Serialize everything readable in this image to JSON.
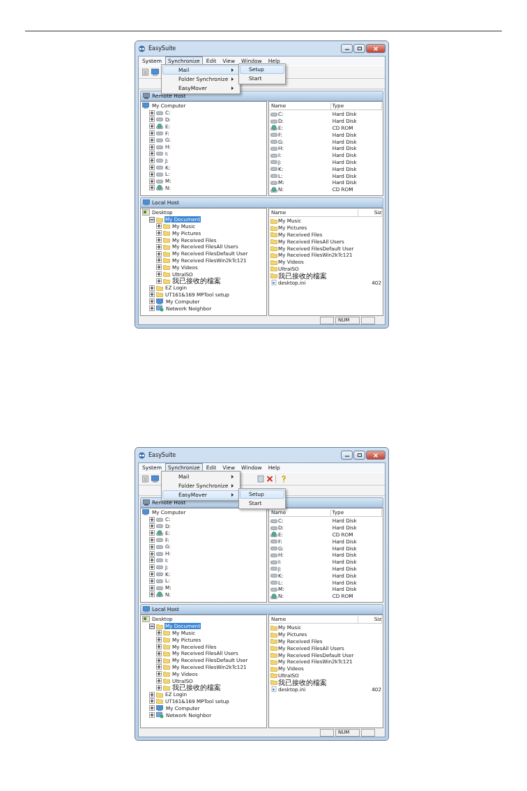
{
  "screenshots": [
    {
      "window": {
        "title": "EasySuite"
      },
      "menu_bar": [
        {
          "label": "System",
          "selected": false
        },
        {
          "label": "Synchronize",
          "selected": true
        },
        {
          "label": "Edit",
          "selected": false
        },
        {
          "label": "View",
          "selected": false
        },
        {
          "label": "Window",
          "selected": false
        },
        {
          "label": "Help",
          "selected": false
        }
      ],
      "open_menu": [
        {
          "label": "Mail",
          "selected": true
        },
        {
          "label": "Folder Synchronize",
          "selected": false
        },
        {
          "label": "EasyMover",
          "selected": false
        }
      ],
      "submenu": [
        {
          "label": "Setup",
          "selected": true
        },
        {
          "label": "Start",
          "selected": false
        }
      ],
      "remote_host": {
        "title": "Remote Host",
        "tree": {
          "label": "My Computer",
          "kind": "computer",
          "selected": false,
          "children": [
            {
              "label": "C:",
              "kind": "disk",
              "expanded": false,
              "selected": false
            },
            {
              "label": "D:",
              "kind": "disk",
              "expanded": false,
              "selected": false
            },
            {
              "label": "E:",
              "kind": "cdrom",
              "expanded": false,
              "selected": false
            },
            {
              "label": "F:",
              "kind": "disk",
              "expanded": false,
              "selected": false
            },
            {
              "label": "G:",
              "kind": "disk",
              "expanded": false,
              "selected": false
            },
            {
              "label": "H:",
              "kind": "disk",
              "expanded": false,
              "selected": false
            },
            {
              "label": "I:",
              "kind": "disk",
              "expanded": false,
              "selected": false
            },
            {
              "label": "J:",
              "kind": "disk",
              "expanded": false,
              "selected": false
            },
            {
              "label": "K:",
              "kind": "disk",
              "expanded": false,
              "selected": false
            },
            {
              "label": "L:",
              "kind": "disk",
              "expanded": false,
              "selected": false
            },
            {
              "label": "M:",
              "kind": "disk",
              "expanded": false,
              "selected": false
            },
            {
              "label": "N:",
              "kind": "cdrom",
              "expanded": false,
              "selected": false
            }
          ]
        },
        "columns": [
          "Name",
          "Type"
        ],
        "rows": [
          {
            "name": "C:",
            "value": "Hard Disk",
            "kind": "disk"
          },
          {
            "name": "D:",
            "value": "Hard Disk",
            "kind": "disk"
          },
          {
            "name": "E:",
            "value": "CD ROM",
            "kind": "cdrom"
          },
          {
            "name": "F:",
            "value": "Hard Disk",
            "kind": "disk"
          },
          {
            "name": "G:",
            "value": "Hard Disk",
            "kind": "disk"
          },
          {
            "name": "H:",
            "value": "Hard Disk",
            "kind": "disk"
          },
          {
            "name": "I:",
            "value": "Hard Disk",
            "kind": "disk"
          },
          {
            "name": "J:",
            "value": "Hard Disk",
            "kind": "disk"
          },
          {
            "name": "K:",
            "value": "Hard Disk",
            "kind": "disk"
          },
          {
            "name": "L:",
            "value": "Hard Disk",
            "kind": "disk"
          },
          {
            "name": "M:",
            "value": "Hard Disk",
            "kind": "disk"
          },
          {
            "name": "N:",
            "value": "CD ROM",
            "kind": "cdrom"
          }
        ]
      },
      "local_host": {
        "title": "Local Host",
        "tree": {
          "label": "Desktop",
          "kind": "desktop",
          "selected": false,
          "children": [
            {
              "label": "My Document",
              "kind": "folder",
              "expanded": true,
              "selected": true,
              "children": [
                {
                  "label": "My Music",
                  "kind": "folder",
                  "expanded": false,
                  "selected": false
                },
                {
                  "label": "My Pictures",
                  "kind": "folder",
                  "expanded": false,
                  "selected": false
                },
                {
                  "label": "My Received Files",
                  "kind": "folder",
                  "expanded": false,
                  "selected": false
                },
                {
                  "label": "My Received FilesAll Users",
                  "kind": "folder",
                  "expanded": false,
                  "selected": false
                },
                {
                  "label": "My Received FilesDefault User",
                  "kind": "folder",
                  "expanded": false,
                  "selected": false
                },
                {
                  "label": "My Received FilesWin2kTc121",
                  "kind": "folder",
                  "expanded": false,
                  "selected": false
                },
                {
                  "label": "My Videos",
                  "kind": "folder",
                  "expanded": false,
                  "selected": false
                },
                {
                  "label": "UltraISO",
                  "kind": "folder",
                  "expanded": false,
                  "selected": false
                },
                {
                  "label": "我已接收的檔案",
                  "kind": "folder",
                  "expanded": false,
                  "selected": false
                }
              ]
            },
            {
              "label": "EZ Login",
              "kind": "folder",
              "expanded": false,
              "selected": false
            },
            {
              "label": "UT161&169 MPTool setup",
              "kind": "folder",
              "expanded": false,
              "selected": false
            },
            {
              "label": "My Computer",
              "kind": "computer",
              "expanded": false,
              "selected": false
            },
            {
              "label": "Network Neighbor",
              "kind": "network",
              "expanded": false,
              "selected": false
            }
          ]
        },
        "columns": [
          "Name",
          "Siz"
        ],
        "rows": [
          {
            "name": "My Music",
            "kind": "folder"
          },
          {
            "name": "My Pictures",
            "kind": "folder"
          },
          {
            "name": "My Received Files",
            "kind": "folder"
          },
          {
            "name": "My Received FilesAll Users",
            "kind": "folder"
          },
          {
            "name": "My Received FilesDefault User",
            "kind": "folder"
          },
          {
            "name": "My Received FilesWin2kTc121",
            "kind": "folder"
          },
          {
            "name": "My Videos",
            "kind": "folder"
          },
          {
            "name": "UltraISO",
            "kind": "folder"
          },
          {
            "name": "我已接收的檔案",
            "kind": "folder"
          },
          {
            "name": "desktop.ini",
            "value": "402",
            "kind": "file"
          }
        ]
      },
      "status_bar": [
        "NUM"
      ]
    },
    {
      "window": {
        "title": "EasySuite"
      },
      "menu_bar": [
        {
          "label": "System",
          "selected": false
        },
        {
          "label": "Synchronize",
          "selected": true
        },
        {
          "label": "Edit",
          "selected": false
        },
        {
          "label": "View",
          "selected": false
        },
        {
          "label": "Window",
          "selected": false
        },
        {
          "label": "Help",
          "selected": false
        }
      ],
      "open_menu": [
        {
          "label": "Mail",
          "selected": false
        },
        {
          "label": "Folder Synchronize",
          "selected": false
        },
        {
          "label": "EasyMover",
          "selected": true
        }
      ],
      "submenu": [
        {
          "label": "Setup",
          "selected": true
        },
        {
          "label": "Start",
          "selected": false
        }
      ],
      "remote_host": {
        "title": "Remote Host",
        "tree": {
          "label": "My Computer",
          "kind": "computer",
          "selected": false,
          "children": [
            {
              "label": "C:",
              "kind": "disk",
              "expanded": false,
              "selected": false
            },
            {
              "label": "D:",
              "kind": "disk",
              "expanded": false,
              "selected": false
            },
            {
              "label": "E:",
              "kind": "cdrom",
              "expanded": false,
              "selected": false
            },
            {
              "label": "F:",
              "kind": "disk",
              "expanded": false,
              "selected": false
            },
            {
              "label": "G:",
              "kind": "disk",
              "expanded": false,
              "selected": false
            },
            {
              "label": "H:",
              "kind": "disk",
              "expanded": false,
              "selected": false
            },
            {
              "label": "I:",
              "kind": "disk",
              "expanded": false,
              "selected": false
            },
            {
              "label": "J:",
              "kind": "disk",
              "expanded": false,
              "selected": false
            },
            {
              "label": "K:",
              "kind": "disk",
              "expanded": false,
              "selected": false
            },
            {
              "label": "L:",
              "kind": "disk",
              "expanded": false,
              "selected": false
            },
            {
              "label": "M:",
              "kind": "disk",
              "expanded": false,
              "selected": false
            },
            {
              "label": "N:",
              "kind": "cdrom",
              "expanded": false,
              "selected": false
            }
          ]
        },
        "columns": [
          "Name",
          "Type"
        ],
        "rows": [
          {
            "name": "C:",
            "value": "Hard Disk",
            "kind": "disk"
          },
          {
            "name": "D:",
            "value": "Hard Disk",
            "kind": "disk"
          },
          {
            "name": "E:",
            "value": "CD ROM",
            "kind": "cdrom"
          },
          {
            "name": "F:",
            "value": "Hard Disk",
            "kind": "disk"
          },
          {
            "name": "G:",
            "value": "Hard Disk",
            "kind": "disk"
          },
          {
            "name": "H:",
            "value": "Hard Disk",
            "kind": "disk"
          },
          {
            "name": "I:",
            "value": "Hard Disk",
            "kind": "disk"
          },
          {
            "name": "J:",
            "value": "Hard Disk",
            "kind": "disk"
          },
          {
            "name": "K:",
            "value": "Hard Disk",
            "kind": "disk"
          },
          {
            "name": "L:",
            "value": "Hard Disk",
            "kind": "disk"
          },
          {
            "name": "M:",
            "value": "Hard Disk",
            "kind": "disk"
          },
          {
            "name": "N:",
            "value": "CD ROM",
            "kind": "cdrom"
          }
        ]
      },
      "local_host": {
        "title": "Local Host",
        "tree": {
          "label": "Desktop",
          "kind": "desktop",
          "selected": false,
          "children": [
            {
              "label": "My Document",
              "kind": "folder",
              "expanded": true,
              "selected": true,
              "children": [
                {
                  "label": "My Music",
                  "kind": "folder",
                  "expanded": false,
                  "selected": false
                },
                {
                  "label": "My Pictures",
                  "kind": "folder",
                  "expanded": false,
                  "selected": false
                },
                {
                  "label": "My Received Files",
                  "kind": "folder",
                  "expanded": false,
                  "selected": false
                },
                {
                  "label": "My Received FilesAll Users",
                  "kind": "folder",
                  "expanded": false,
                  "selected": false
                },
                {
                  "label": "My Received FilesDefault User",
                  "kind": "folder",
                  "expanded": false,
                  "selected": false
                },
                {
                  "label": "My Received FilesWin2kTc121",
                  "kind": "folder",
                  "expanded": false,
                  "selected": false
                },
                {
                  "label": "My Videos",
                  "kind": "folder",
                  "expanded": false,
                  "selected": false
                },
                {
                  "label": "UltraISO",
                  "kind": "folder",
                  "expanded": false,
                  "selected": false
                },
                {
                  "label": "我已接收的檔案",
                  "kind": "folder",
                  "expanded": false,
                  "selected": false
                }
              ]
            },
            {
              "label": "EZ Login",
              "kind": "folder",
              "expanded": false,
              "selected": false
            },
            {
              "label": "UT161&169 MPTool setup",
              "kind": "folder",
              "expanded": false,
              "selected": false
            },
            {
              "label": "My Computer",
              "kind": "computer",
              "expanded": false,
              "selected": false
            },
            {
              "label": "Network Neighbor",
              "kind": "network",
              "expanded": false,
              "selected": false
            }
          ]
        },
        "columns": [
          "Name",
          "Siz"
        ],
        "rows": [
          {
            "name": "My Music",
            "kind": "folder"
          },
          {
            "name": "My Pictures",
            "kind": "folder"
          },
          {
            "name": "My Received Files",
            "kind": "folder"
          },
          {
            "name": "My Received FilesAll Users",
            "kind": "folder"
          },
          {
            "name": "My Received FilesDefault User",
            "kind": "folder"
          },
          {
            "name": "My Received FilesWin2kTc121",
            "kind": "folder"
          },
          {
            "name": "My Videos",
            "kind": "folder"
          },
          {
            "name": "UltraISO",
            "kind": "folder"
          },
          {
            "name": "我已接收的檔案",
            "kind": "folder"
          },
          {
            "name": "desktop.ini",
            "value": "402",
            "kind": "file"
          }
        ]
      },
      "status_bar": [
        "NUM"
      ]
    }
  ]
}
